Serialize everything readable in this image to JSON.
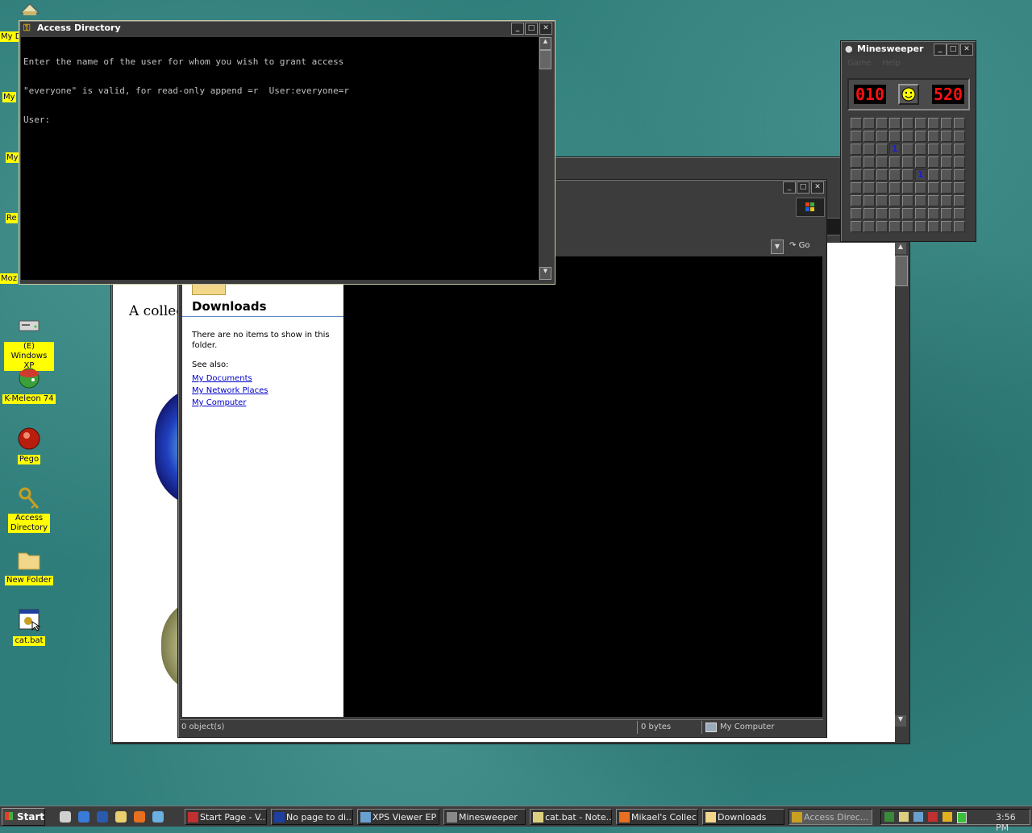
{
  "desktop": {
    "edge_labels": [
      "My D",
      "My",
      "My",
      "Re",
      "Moz"
    ],
    "icons": [
      {
        "label": "(E) Windows XP",
        "icon": "drive-icon"
      },
      {
        "label": "K-Meleon 74",
        "icon": "k-meleon-icon"
      },
      {
        "label": "Pego",
        "icon": "pego-icon"
      },
      {
        "label": "Access Directory",
        "icon": "keys-icon"
      },
      {
        "label": "New Folder",
        "icon": "folder-icon"
      },
      {
        "label": "cat.bat",
        "icon": "batch-file-icon"
      }
    ]
  },
  "console": {
    "title": "Access Directory",
    "lines": [
      "Enter the name of the user for whom you wish to grant access",
      "\"everyone\" is valid, for read-only append =r  User:everyone=r",
      "User:"
    ]
  },
  "minesweeper": {
    "title": "Minesweeper",
    "menu": [
      "Game",
      "Help"
    ],
    "mine_counter": "010",
    "timer": "520",
    "face": "smiley-icon",
    "revealed": [
      {
        "row": 2,
        "col": 3,
        "value": "1"
      },
      {
        "row": 4,
        "col": 5,
        "value": "1"
      }
    ]
  },
  "browser": {
    "page_text": "A collec"
  },
  "explorer": {
    "go_label": "Go",
    "panel_title": "Downloads",
    "empty_text": "There are no items to show in this folder.",
    "see_also_label": "See also:",
    "links": [
      "My Documents",
      "My Network Places",
      "My Computer"
    ],
    "status": {
      "objects": "0 object(s)",
      "size": "0 bytes",
      "location": "My Computer"
    }
  },
  "taskbar": {
    "start_label": "Start",
    "quick_launch": [
      "show-desktop-icon",
      "ie-icon",
      "outlook-icon",
      "explorer-icon",
      "firefox-icon",
      "arrow-icon"
    ],
    "tasks": [
      {
        "label": "Start Page - V...",
        "active": false
      },
      {
        "label": "No page to di...",
        "active": false
      },
      {
        "label": "XPS Viewer EP",
        "active": false
      },
      {
        "label": "Minesweeper",
        "active": false
      },
      {
        "label": "cat.bat - Note...",
        "active": false
      },
      {
        "label": "Mikael's Collec...",
        "active": false
      },
      {
        "label": "Downloads",
        "active": false
      },
      {
        "label": "Access Direc...",
        "active": true
      }
    ],
    "clock": "3:56 PM"
  }
}
